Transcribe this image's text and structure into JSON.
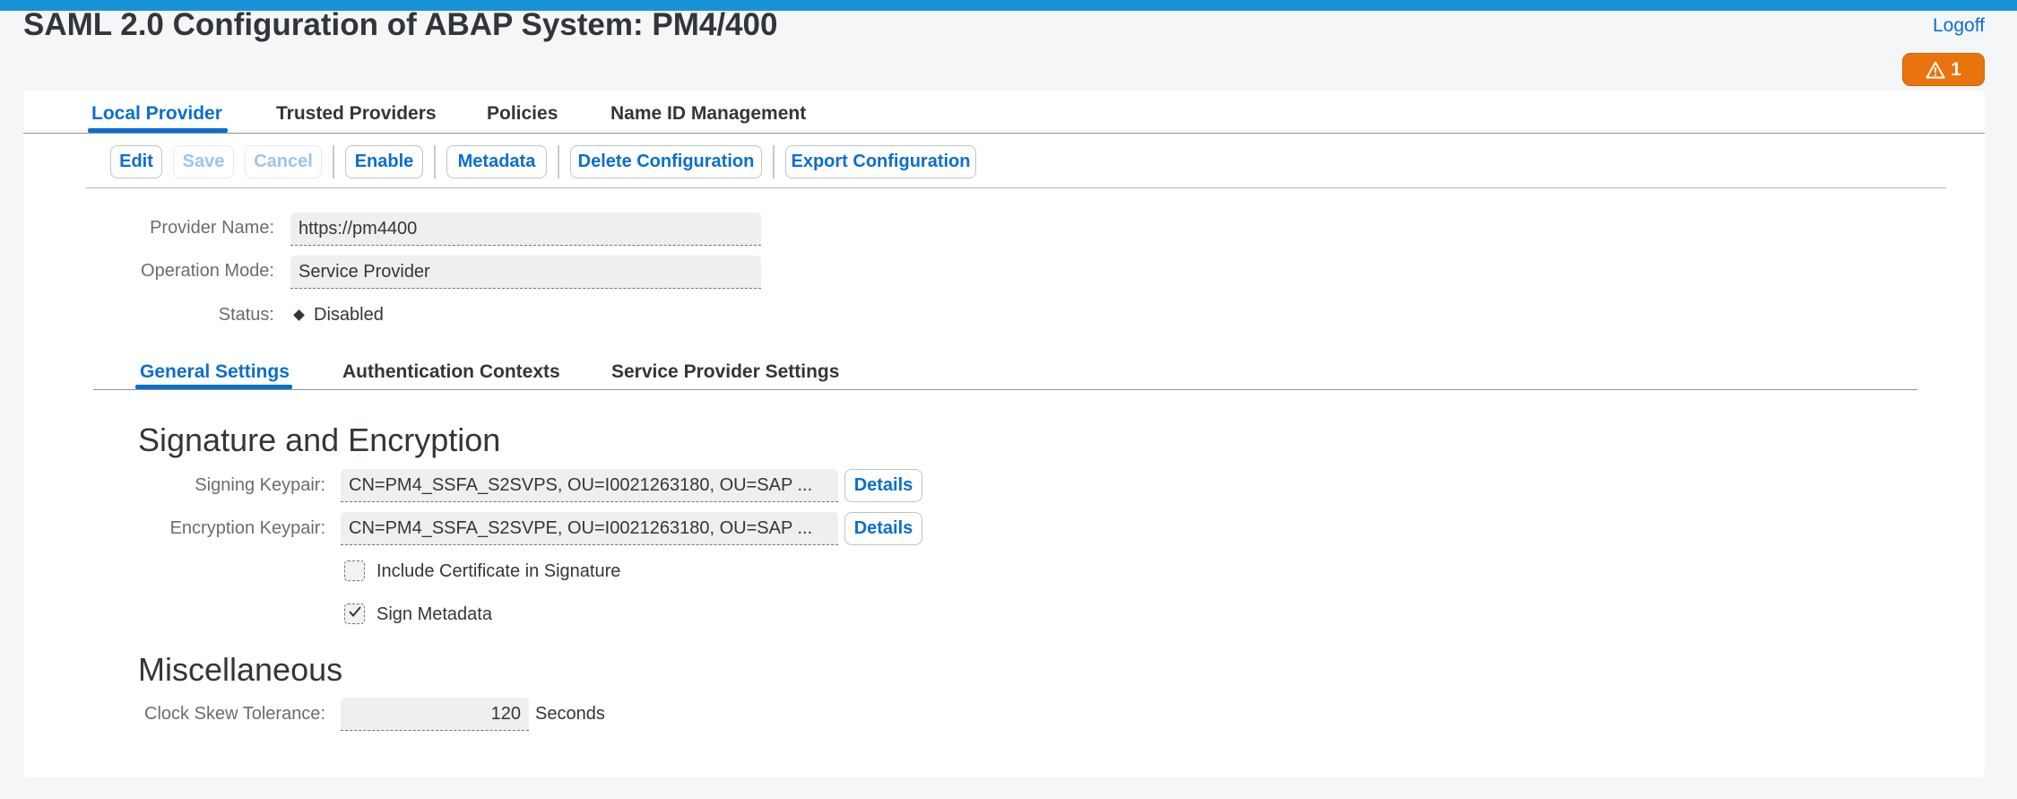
{
  "page": {
    "title": "SAML 2.0 Configuration of ABAP System: PM4/400",
    "logoff": "Logoff",
    "message_count": "1"
  },
  "main_tabs": [
    {
      "label": "Local Provider",
      "active": true
    },
    {
      "label": "Trusted Providers",
      "active": false
    },
    {
      "label": "Policies",
      "active": false
    },
    {
      "label": "Name ID Management",
      "active": false
    }
  ],
  "toolbar": {
    "edit": "Edit",
    "save": "Save",
    "cancel": "Cancel",
    "enable": "Enable",
    "metadata": "Metadata",
    "delete_configuration": "Delete Configuration",
    "export_configuration": "Export Configuration"
  },
  "provider": {
    "name_label": "Provider Name:",
    "name_value": "https://pm4400",
    "mode_label": "Operation Mode:",
    "mode_value": "Service Provider",
    "status_label": "Status:",
    "status_value": "Disabled"
  },
  "sub_tabs": [
    {
      "label": "General Settings",
      "active": true
    },
    {
      "label": "Authentication Contexts",
      "active": false
    },
    {
      "label": "Service Provider Settings",
      "active": false
    }
  ],
  "signature": {
    "title": "Signature and Encryption",
    "signing_label": "Signing Keypair:",
    "signing_value": "CN=PM4_SSFA_S2SVPS, OU=I0021263180, OU=SAP ...",
    "encryption_label": "Encryption Keypair:",
    "encryption_value": "CN=PM4_SSFA_S2SVPE, OU=I0021263180, OU=SAP ...",
    "details": "Details",
    "include_cert_label": "Include Certificate in Signature",
    "include_cert_checked": false,
    "sign_metadata_label": "Sign Metadata",
    "sign_metadata_checked": true
  },
  "misc": {
    "title": "Miscellaneous",
    "clock_label": "Clock Skew Tolerance:",
    "clock_value": "120",
    "clock_unit": "Seconds"
  },
  "colors": {
    "accent": "#0a6ed1",
    "top_bar": "#1893d8",
    "warning": "#e9730c"
  }
}
